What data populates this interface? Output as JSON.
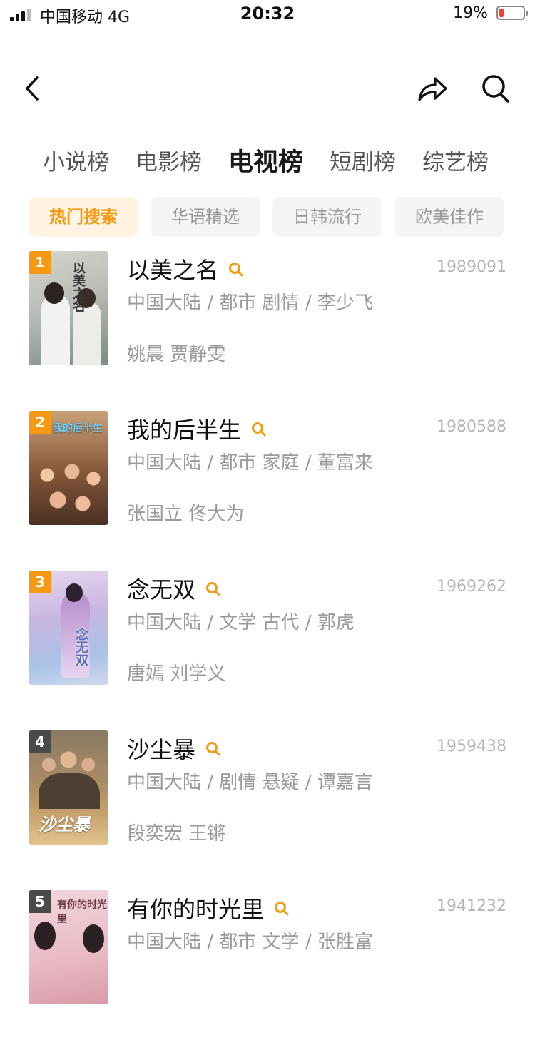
{
  "status_bar": {
    "carrier": "中国移动  4G",
    "time": "20:32",
    "battery": "19%"
  },
  "nav": {
    "back_icon": "chevron-left-icon",
    "share_icon": "share-arrow-icon",
    "search_icon": "search-icon"
  },
  "tabs": [
    {
      "label": "小说榜",
      "active": false
    },
    {
      "label": "电影榜",
      "active": false
    },
    {
      "label": "电视榜",
      "active": true
    },
    {
      "label": "短剧榜",
      "active": false
    },
    {
      "label": "综艺榜",
      "active": false
    }
  ],
  "filters": [
    {
      "label": "热门搜索",
      "active": true
    },
    {
      "label": "华语精选",
      "active": false
    },
    {
      "label": "日韩流行",
      "active": false
    },
    {
      "label": "欧美佳作",
      "active": false
    }
  ],
  "accent_color": "#f59a12",
  "items": [
    {
      "rank": "1",
      "title": "以美之名",
      "poster_text": "以美之名",
      "count": "1989091",
      "meta": "中国大陆 / 都市 剧情 / 李少飞",
      "cast": "姚晨 贾静雯"
    },
    {
      "rank": "2",
      "title": "我的后半生",
      "poster_text": "我的后半生",
      "count": "1980588",
      "meta": "中国大陆 / 都市 家庭 / 董富来",
      "cast": "张国立 佟大为"
    },
    {
      "rank": "3",
      "title": "念无双",
      "poster_text": "念无双",
      "count": "1969262",
      "meta": "中国大陆 / 文学 古代 / 郭虎",
      "cast": "唐嫣 刘学义"
    },
    {
      "rank": "4",
      "title": "沙尘暴",
      "poster_text": "沙尘暴",
      "count": "1959438",
      "meta": "中国大陆 / 剧情 悬疑 / 谭嘉言",
      "cast": "段奕宏 王锵"
    },
    {
      "rank": "5",
      "title": "有你的时光里",
      "poster_text": "有你的时光里",
      "count": "1941232",
      "meta": "中国大陆 / 都市 文学 / 张胜富",
      "cast": ""
    }
  ]
}
